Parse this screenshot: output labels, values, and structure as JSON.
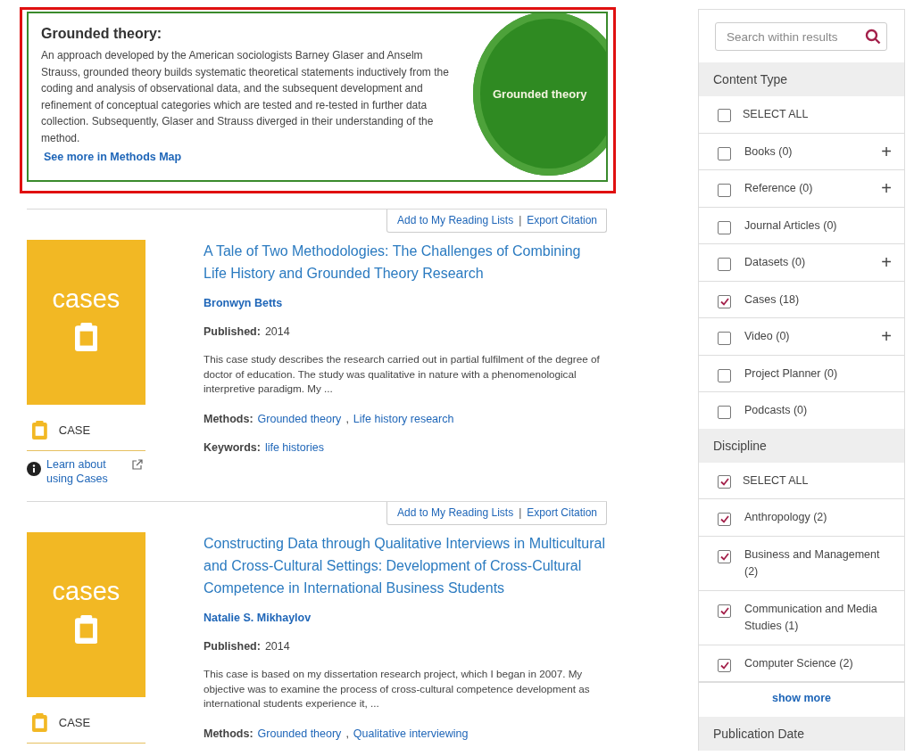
{
  "concept": {
    "heading": "Grounded theory:",
    "description": "An approach developed by the American sociologists Barney Glaser and Anselm Strauss, grounded theory builds systematic theoretical statements inductively from the coding and analysis of observational data, and the subsequent development and refinement of conceptual categories which are tested and re-tested in further data collection. Subsequently, Glaser and Strauss diverged in their understanding of the method.",
    "link": "See more in Methods Map",
    "circle_label": "Grounded theory"
  },
  "results": [
    {
      "actions": [
        "Add to My Reading Lists",
        "Export Citation"
      ],
      "action_separator": "|",
      "method_separator": ",",
      "thumb_label": "cases",
      "type_label": "CASE",
      "learn_more": "Learn about using Cases",
      "title": "A Tale of Two Methodologies: The Challenges of Combining Life History and Grounded Theory Research",
      "author": "Bronwyn Betts",
      "published_label": "Published:",
      "published": "2014",
      "abstract": "This case study describes the research carried out in partial fulfilment of the degree of doctor of education. The study was qualitative in nature with a phenomenological interpretive paradigm. My ...",
      "methods_label": "Methods:",
      "methods": [
        "Grounded theory",
        "Life history research"
      ],
      "keywords_label": "Keywords:",
      "keywords": [
        "life histories"
      ]
    },
    {
      "actions": [
        "Add to My Reading Lists",
        "Export Citation"
      ],
      "action_separator": "|",
      "method_separator": ",",
      "thumb_label": "cases",
      "type_label": "CASE",
      "title": "Constructing Data through Qualitative Interviews in Multicultural and Cross-Cultural Settings: Development of Cross-Cultural Competence in International Business Students",
      "author": "Natalie S. Mikhaylov",
      "published_label": "Published:",
      "published": "2014",
      "abstract": "This case is based on my dissertation research project, which I began in 2007. My objective was to examine the process of cross-cultural competence development as international students experience it, ...",
      "methods_label": "Methods:",
      "methods": [
        "Grounded theory",
        "Qualitative interviewing"
      ]
    }
  ],
  "sidebar": {
    "search": {
      "placeholder": "Search within results"
    },
    "sections": [
      {
        "title": "Content Type",
        "options": [
          {
            "label": "SELECT ALL",
            "checked": false
          },
          {
            "label": "Books (0)",
            "checked": false,
            "expander": "+"
          },
          {
            "label": "Reference (0)",
            "checked": false,
            "expander": "+"
          },
          {
            "label": "Journal Articles (0)",
            "checked": false
          },
          {
            "label": "Datasets (0)",
            "checked": false,
            "expander": "+"
          },
          {
            "label": "Cases (18)",
            "checked": true
          },
          {
            "label": "Video (0)",
            "checked": false,
            "expander": "+"
          },
          {
            "label": "Project Planner (0)",
            "checked": false
          },
          {
            "label": "Podcasts (0)",
            "checked": false
          }
        ]
      },
      {
        "title": "Discipline",
        "options": [
          {
            "label": "SELECT ALL",
            "checked": true
          },
          {
            "label": "Anthropology (2)",
            "checked": true
          },
          {
            "label": "Business and Management (2)",
            "checked": true
          },
          {
            "label": "Communication and Media Studies (1)",
            "checked": true
          },
          {
            "label": "Computer Science (2)",
            "checked": true
          }
        ],
        "show_more": "show more"
      },
      {
        "title": "Publication Date"
      }
    ]
  }
}
